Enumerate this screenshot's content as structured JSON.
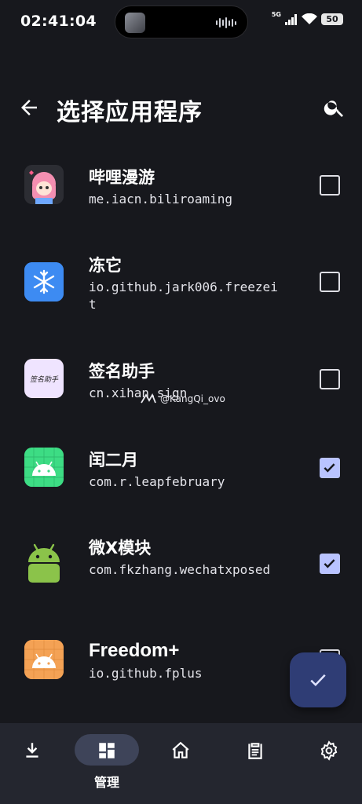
{
  "status_bar": {
    "time": "02:41:04",
    "network": "5G",
    "battery": "50"
  },
  "app_bar": {
    "title": "选择应用程序"
  },
  "apps": [
    {
      "name": "哔哩漫游",
      "package": "me.iacn.biliroaming",
      "checked": false,
      "icon": "biliroaming-anime-icon"
    },
    {
      "name": "冻它",
      "package": "io.github.jark006.freezeit",
      "checked": false,
      "icon": "snowflake-icon"
    },
    {
      "name": "签名助手",
      "package": "cn.xihan.sign",
      "checked": false,
      "icon": "sign-helper-icon",
      "icon_text": "签名助手"
    },
    {
      "name": "闰二月",
      "package": "com.r.leapfebruary",
      "checked": true,
      "icon": "android-icon"
    },
    {
      "name": "微X模块",
      "package": "com.fkzhang.wechatxposed",
      "checked": true,
      "icon": "android-icon"
    },
    {
      "name": "Freedom+",
      "package": "io.github.fplus",
      "checked": false,
      "icon": "android-icon"
    }
  ],
  "watermark": "@KangQi_ovo",
  "fab": {
    "icon": "check-icon"
  },
  "bottom_nav": {
    "items": [
      {
        "icon": "download-icon",
        "label": ""
      },
      {
        "icon": "dashboard-icon",
        "label": "管理",
        "active": true
      },
      {
        "icon": "home-icon",
        "label": ""
      },
      {
        "icon": "clipboard-icon",
        "label": ""
      },
      {
        "icon": "settings-icon",
        "label": ""
      }
    ]
  },
  "colors": {
    "background": "#17181d",
    "checkbox_checked": "#b9c3ff",
    "fab": "#2f3d75",
    "nav_bar": "#24262f",
    "nav_active_pill": "#3e4459"
  }
}
